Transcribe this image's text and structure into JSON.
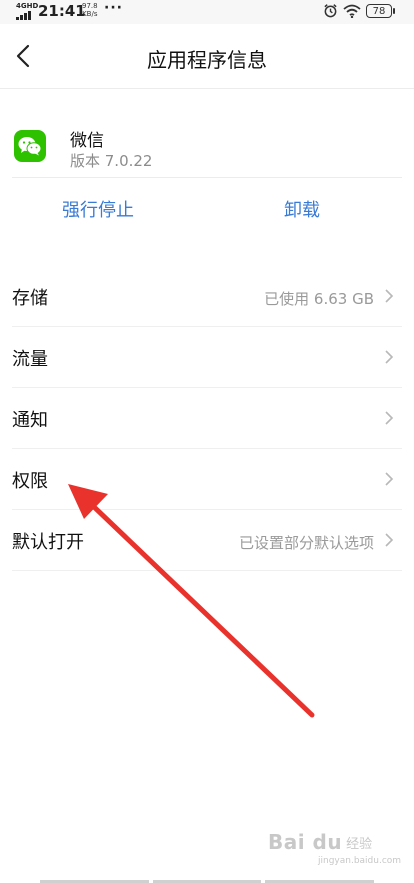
{
  "status_bar": {
    "network": "4GHD",
    "time": "21:41",
    "speed_value": "97.8",
    "speed_unit": "KB/s",
    "more": "···",
    "battery": "78"
  },
  "header": {
    "title": "应用程序信息"
  },
  "app": {
    "name": "微信",
    "version": "版本 7.0.22"
  },
  "actions": {
    "force_stop": "强行停止",
    "uninstall": "卸载"
  },
  "list": [
    {
      "label": "存储",
      "value": "已使用 6.63 GB"
    },
    {
      "label": "流量",
      "value": ""
    },
    {
      "label": "通知",
      "value": ""
    },
    {
      "label": "权限",
      "value": ""
    },
    {
      "label": "默认打开",
      "value": "已设置部分默认选项"
    }
  ],
  "watermark": {
    "logo": "Bai du",
    "text": "经验",
    "url": "jingyan.baidu.com"
  },
  "colors": {
    "accent": "#3a7bd5",
    "wechat_green": "#2dc100",
    "annotation_arrow": "#e8322b"
  }
}
